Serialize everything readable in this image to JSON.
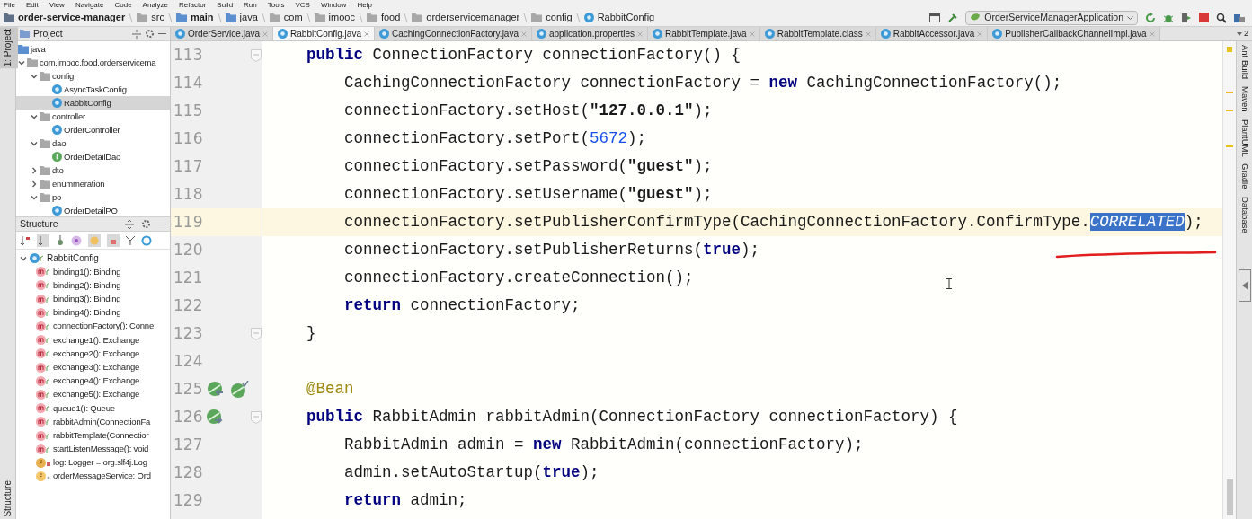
{
  "menu_bar": [
    "File",
    "Edit",
    "View",
    "Navigate",
    "Code",
    "Analyze",
    "Refactor",
    "Build",
    "Run",
    "Tools",
    "VCS",
    "Window",
    "Help"
  ],
  "breadcrumbs": [
    {
      "label": "order-service-manager",
      "kind": "project"
    },
    {
      "label": "src",
      "kind": "folder"
    },
    {
      "label": "main",
      "kind": "source"
    },
    {
      "label": "java",
      "kind": "source"
    },
    {
      "label": "com",
      "kind": "folder"
    },
    {
      "label": "imooc",
      "kind": "folder"
    },
    {
      "label": "food",
      "kind": "folder"
    },
    {
      "label": "orderservicemanager",
      "kind": "folder"
    },
    {
      "label": "config",
      "kind": "folder"
    },
    {
      "label": "RabbitConfig",
      "kind": "class"
    }
  ],
  "run_config": "OrderServiceManagerApplication",
  "left_strip": {
    "top": "1: Project",
    "bottom": "Structure"
  },
  "project_panel": {
    "title": "Project",
    "tree": [
      {
        "label": "java",
        "kind": "source",
        "selected": false
      },
      {
        "label": "com.imooc.food.orderservicema",
        "kind": "folder",
        "expanded": true,
        "selected": false,
        "children": [
          {
            "label": "config",
            "kind": "folder",
            "expanded": true,
            "selected": false,
            "children": [
              {
                "label": "AsyncTaskConfig",
                "kind": "class",
                "selected": false
              },
              {
                "label": "RabbitConfig",
                "kind": "class",
                "selected": true
              }
            ]
          },
          {
            "label": "controller",
            "kind": "folder",
            "expanded": true,
            "selected": false,
            "children": [
              {
                "label": "OrderController",
                "kind": "class",
                "selected": false
              }
            ]
          },
          {
            "label": "dao",
            "kind": "folder",
            "expanded": true,
            "selected": false,
            "children": [
              {
                "label": "OrderDetailDao",
                "kind": "interface",
                "selected": false
              }
            ]
          },
          {
            "label": "dto",
            "kind": "folder",
            "expanded": false,
            "selected": false
          },
          {
            "label": "enummeration",
            "kind": "folder",
            "expanded": false,
            "selected": false
          },
          {
            "label": "po",
            "kind": "folder",
            "expanded": true,
            "selected": false,
            "children": [
              {
                "label": "OrderDetailPO",
                "kind": "class",
                "selected": false
              }
            ]
          }
        ]
      }
    ]
  },
  "structure_panel": {
    "title": "Structure",
    "root": {
      "label": "RabbitConfig",
      "expanded": true,
      "children": [
        {
          "label": "binding1(): Binding",
          "kind": "method"
        },
        {
          "label": "binding2(): Binding",
          "kind": "method"
        },
        {
          "label": "binding3(): Binding",
          "kind": "method"
        },
        {
          "label": "binding4(): Binding",
          "kind": "method"
        },
        {
          "label": "connectionFactory(): Conne",
          "kind": "method"
        },
        {
          "label": "exchange1(): Exchange",
          "kind": "method"
        },
        {
          "label": "exchange2(): Exchange",
          "kind": "method"
        },
        {
          "label": "exchange3(): Exchange",
          "kind": "method"
        },
        {
          "label": "exchange4(): Exchange",
          "kind": "method"
        },
        {
          "label": "exchange5(): Exchange",
          "kind": "method"
        },
        {
          "label": "queue1(): Queue",
          "kind": "method"
        },
        {
          "label": "rabbitAdmin(ConnectionFa",
          "kind": "method"
        },
        {
          "label": "rabbitTemplate(Connectior",
          "kind": "method"
        },
        {
          "label": "startListenMessage(): void",
          "kind": "method"
        },
        {
          "label": "log: Logger = org.slf4j.Log",
          "kind": "static_field"
        },
        {
          "label": "orderMessageService: Ord",
          "kind": "field"
        }
      ]
    }
  },
  "tabs": [
    {
      "label": "OrderService.java",
      "selected": false
    },
    {
      "label": "RabbitConfig.java",
      "selected": true
    },
    {
      "label": "CachingConnectionFactory.java",
      "selected": false
    },
    {
      "label": "application.properties",
      "selected": false
    },
    {
      "label": "RabbitTemplate.java",
      "selected": false
    },
    {
      "label": "RabbitTemplate.class",
      "selected": false
    },
    {
      "label": "RabbitAccessor.java",
      "selected": false
    },
    {
      "label": "PublisherCallbackChannelImpl.java",
      "selected": false
    }
  ],
  "tab_count": "2",
  "editor": {
    "lines": [
      {
        "number": "113",
        "current": false,
        "fold": true,
        "tokens": [
          {
            "text": "public",
            "kind": "keyword"
          },
          {
            "text": " ConnectionFactory connectionFactory() {",
            "kind": "plain"
          }
        ],
        "children": [
          {
            "number": "114",
            "current": false,
            "fold": false,
            "tokens": [
              {
                "text": "CachingConnectionFactory connectionFactory = ",
                "kind": "plain"
              },
              {
                "text": "new",
                "kind": "keyword"
              },
              {
                "text": " CachingConnectionFactory();",
                "kind": "plain"
              }
            ]
          },
          {
            "number": "115",
            "current": false,
            "fold": false,
            "tokens": [
              {
                "text": "connectionFactory.setHost(",
                "kind": "plain"
              },
              {
                "text": "\"127.0.0.1\"",
                "kind": "string"
              },
              {
                "text": ");",
                "kind": "plain"
              }
            ]
          },
          {
            "number": "116",
            "current": false,
            "fold": false,
            "tokens": [
              {
                "text": "connectionFactory.setPort(",
                "kind": "plain"
              },
              {
                "text": "5672",
                "kind": "number"
              },
              {
                "text": ");",
                "kind": "plain"
              }
            ]
          },
          {
            "number": "117",
            "current": false,
            "fold": false,
            "tokens": [
              {
                "text": "connectionFactory.setPassword(",
                "kind": "plain"
              },
              {
                "text": "\"guest\"",
                "kind": "string"
              },
              {
                "text": ");",
                "kind": "plain"
              }
            ]
          },
          {
            "number": "118",
            "current": false,
            "fold": false,
            "tokens": [
              {
                "text": "connectionFactory.setUsername(",
                "kind": "plain"
              },
              {
                "text": "\"guest\"",
                "kind": "string"
              },
              {
                "text": ");",
                "kind": "plain"
              }
            ]
          },
          {
            "number": "119",
            "current": true,
            "fold": false,
            "tokens": [
              {
                "text": "connectionFactory.setPublisherConfirmType(CachingConnectionFactory.ConfirmType.",
                "kind": "plain"
              },
              {
                "text": "CORRELATED",
                "kind": "selection"
              },
              {
                "text": ");",
                "kind": "plain"
              }
            ]
          },
          {
            "number": "120",
            "current": false,
            "fold": false,
            "tokens": [
              {
                "text": "connectionFactory.setPublisherReturns(",
                "kind": "plain"
              },
              {
                "text": "true",
                "kind": "keyword"
              },
              {
                "text": ");",
                "kind": "plain"
              }
            ]
          },
          {
            "number": "121",
            "current": false,
            "fold": false,
            "tokens": [
              {
                "text": "connectionFactory.createConnection();",
                "kind": "plain"
              }
            ]
          },
          {
            "number": "122",
            "current": false,
            "fold": false,
            "tokens": [
              {
                "text": "return",
                "kind": "keyword"
              },
              {
                "text": " connectionFactory;",
                "kind": "plain"
              }
            ]
          }
        ]
      },
      {
        "number": "123",
        "current": false,
        "fold": true,
        "tokens": [
          {
            "text": "}",
            "kind": "plain"
          }
        ]
      },
      {
        "number": "124",
        "current": false,
        "fold": false
      },
      {
        "number": "125",
        "current": false,
        "fold": false,
        "kind": "bean",
        "tokens": [
          {
            "text": "@Bean",
            "kind": "annotation"
          }
        ]
      },
      {
        "number": "126",
        "current": false,
        "fold": true,
        "kind": "impl",
        "tokens": [
          {
            "text": "public",
            "kind": "keyword"
          },
          {
            "text": " RabbitAdmin rabbitAdmin(ConnectionFactory connectionFactory) {",
            "kind": "plain"
          }
        ],
        "children": [
          {
            "number": "127",
            "current": false,
            "fold": false,
            "tokens": [
              {
                "text": "RabbitAdmin admin = ",
                "kind": "plain"
              },
              {
                "text": "new",
                "kind": "keyword"
              },
              {
                "text": " RabbitAdmin(connectionFactory);",
                "kind": "plain"
              }
            ]
          },
          {
            "number": "128",
            "current": false,
            "fold": false,
            "tokens": [
              {
                "text": "admin.setAutoStartup(",
                "kind": "plain"
              },
              {
                "text": "true",
                "kind": "keyword"
              },
              {
                "text": ");",
                "kind": "plain"
              }
            ]
          },
          {
            "number": "129",
            "current": false,
            "fold": false,
            "tokens": [
              {
                "text": "return",
                "kind": "keyword"
              },
              {
                "text": " admin;",
                "kind": "plain"
              }
            ]
          }
        ]
      }
    ]
  },
  "right_strip": [
    "Ant Build",
    "Maven",
    "PlantUML",
    "Gradle",
    "Database"
  ]
}
